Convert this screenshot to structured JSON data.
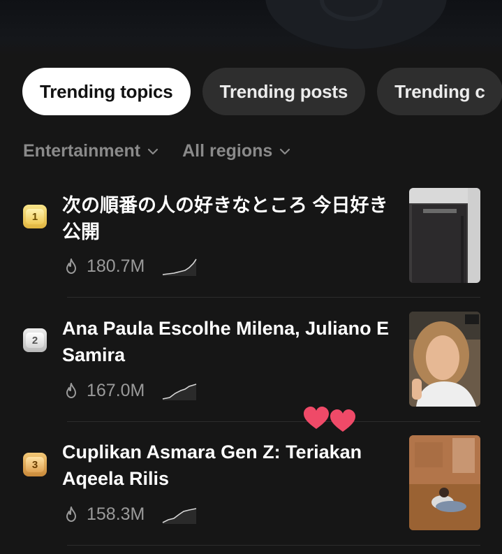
{
  "tabs": [
    {
      "label": "Trending topics",
      "active": true
    },
    {
      "label": "Trending posts",
      "active": false
    },
    {
      "label": "Trending c",
      "active": false
    }
  ],
  "filters": {
    "category": "Entertainment",
    "region": "All regions"
  },
  "items": [
    {
      "rank": "1",
      "title": "次の順番の人の好きなところ 今日好き 公開",
      "views": "180.7M"
    },
    {
      "rank": "2",
      "title": "Ana Paula Escolhe Milena, Juliano E Samira",
      "views": "167.0M"
    },
    {
      "rank": "3",
      "title": "Cuplikan Asmara Gen Z: Teriakan Aqeela Rilis",
      "views": "158.3M"
    }
  ],
  "icons": {
    "chevron": "chevron-down-icon",
    "flame": "flame-icon",
    "trend": "trend-sparkline-icon"
  },
  "colors": {
    "background": "#161616",
    "active_tab": "#ffffff",
    "inactive_tab": "#2e2e2e",
    "muted_text": "#8a8a8a",
    "heart": "#ef4a68"
  }
}
